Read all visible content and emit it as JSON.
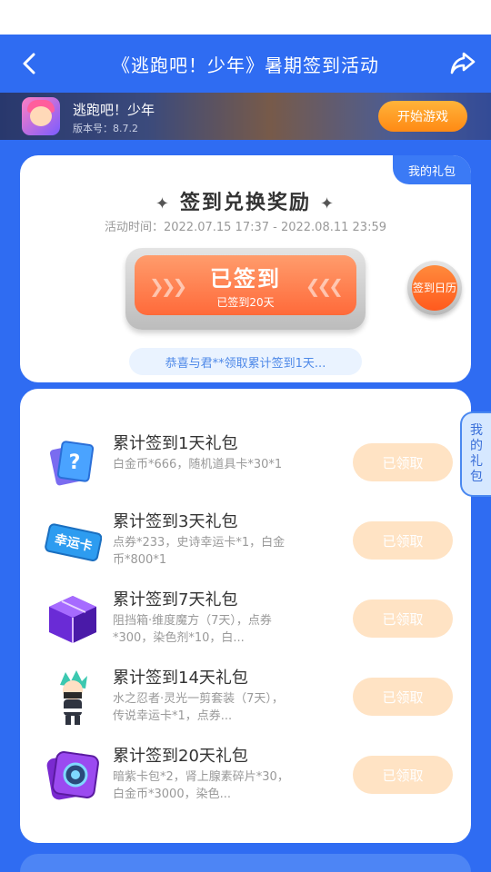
{
  "header": {
    "title": "《逃跑吧！少年》暑期签到活动",
    "back_icon": "chevron-left-icon",
    "share_icon": "share-icon"
  },
  "game": {
    "name": "逃跑吧！少年",
    "version": "版本号：8.7.2",
    "start_label": "开始游戏"
  },
  "signin": {
    "gift_tab": "我的礼包",
    "title": "签到兑换奖励",
    "time": "活动时间：2022.07.15 17:37 - 2022.08.11 23:59",
    "button_main": "已签到",
    "button_sub": "已签到20天",
    "calendar_label": "签到日历",
    "notice": "恭喜与君**领取累计签到1天..."
  },
  "side_tab": "我的礼包",
  "rewards": [
    {
      "title": "累计签到1天礼包",
      "desc": "白金币*666，随机道具卡*30*1",
      "button": "已领取"
    },
    {
      "title": "累计签到3天礼包",
      "desc": "点券*233，史诗幸运卡*1，白金币*800*1",
      "button": "已领取"
    },
    {
      "title": "累计签到7天礼包",
      "desc": "阻挡箱·维度魔方（7天），点券*300，染色剂*10，白...",
      "button": "已领取"
    },
    {
      "title": "累计签到14天礼包",
      "desc": "水之忍者·灵光一剪套装（7天），传说幸运卡*1，点券...",
      "button": "已领取"
    },
    {
      "title": "累计签到20天礼包",
      "desc": "暗紫卡包*2，肾上腺素碎片*30，白金币*3000，染色...",
      "button": "已领取"
    }
  ],
  "reward_icons": [
    "mystery-card-icon",
    "lucky-card-icon",
    "purple-cube-icon",
    "ninja-character-icon",
    "purple-card-pack-icon"
  ],
  "lucky_card_text": "幸运卡",
  "colors": {
    "primary_blue": "#2f6cf2",
    "sign_orange": "#ff7a48",
    "claimed_button": "#ffe3c4",
    "notice_text": "#4d88e8"
  }
}
